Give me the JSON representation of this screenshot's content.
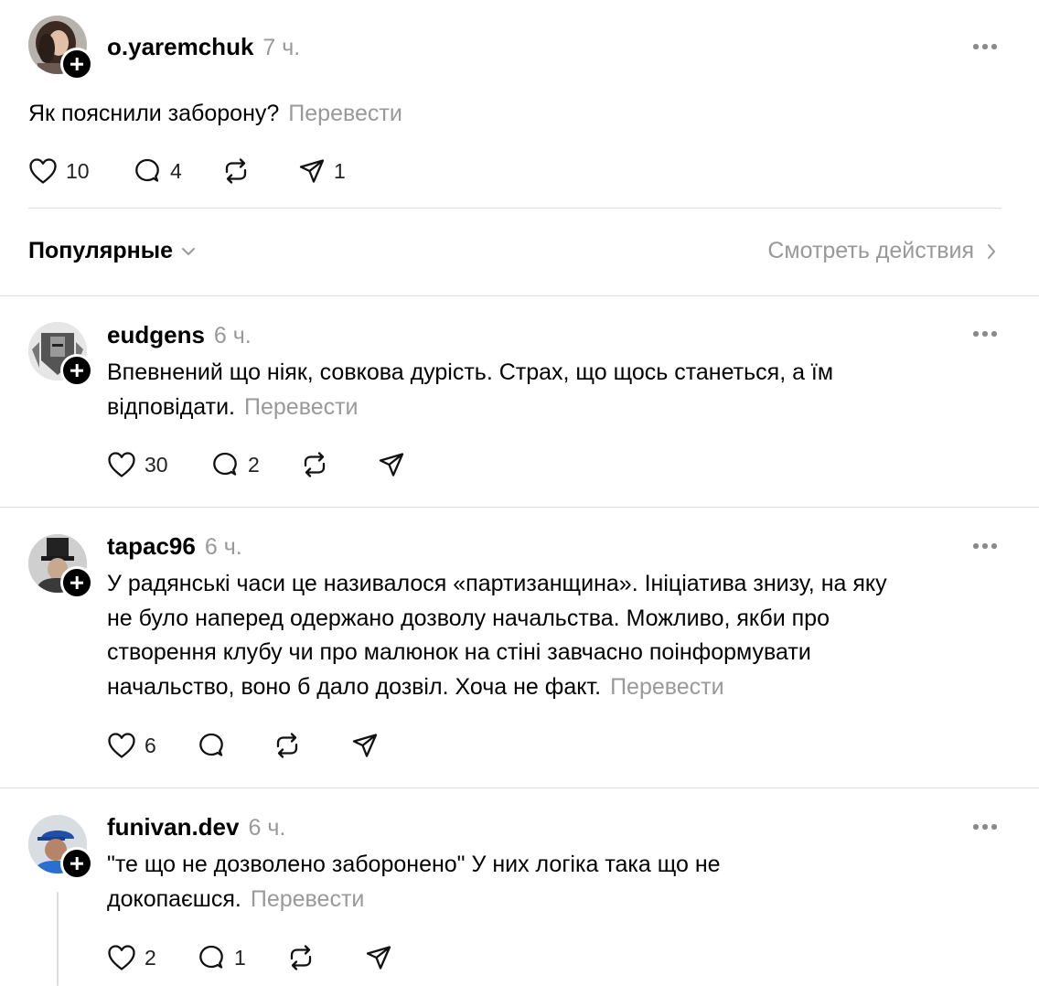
{
  "translate_label": "Перевести",
  "main_post": {
    "username": "o.yaremchuk",
    "time": "7 ч.",
    "text": "Як пояснили заборону?",
    "likes": "10",
    "comments": "4",
    "shares": "1"
  },
  "sort_bar": {
    "sort_label": "Популярные",
    "view_activity_label": "Смотреть действия"
  },
  "replies": [
    {
      "username": "eudgens",
      "time": "6 ч.",
      "text_lines": [
        "Впевнений що ніяк, совкова дурість. Страх, що щось станеться, а їм",
        "відповідати."
      ],
      "likes": "30",
      "comments": "2"
    },
    {
      "username": "tapac96",
      "time": "6 ч.",
      "text_lines": [
        "У радянські часи це називалося «партизанщина». Ініціатива знизу, на яку",
        "не було наперед одержано дозволу начальства. Можливо, якби про",
        "створення клубу чи про малюнок на стіні завчасно поінформувати",
        "начальство, воно б дало дозвіл. Хоча не факт."
      ],
      "likes": "6"
    },
    {
      "username": "funivan.dev",
      "time": "6 ч.",
      "text_lines": [
        "\"те що не дозволено заборонено\" У них логіка така що не",
        "докопаєшся."
      ],
      "likes": "2",
      "comments": "1"
    }
  ],
  "icons": {
    "like": "heart-icon",
    "comment": "comment-bubble-icon",
    "repost": "repost-icon",
    "share": "send-icon",
    "more": "more-dots-icon",
    "follow": "plus-icon"
  }
}
